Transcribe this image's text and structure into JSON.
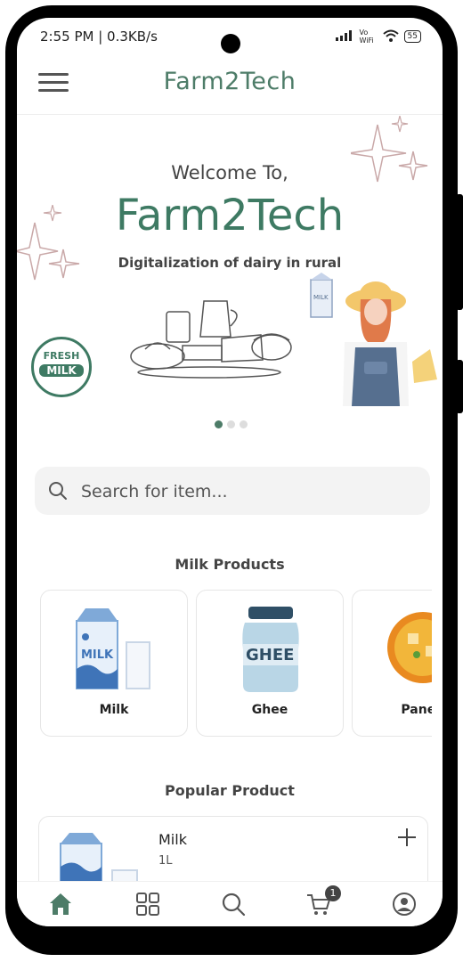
{
  "status_bar": {
    "time": "2:55 PM | 0.3KB/s",
    "network_label": "Vo WiFi",
    "battery": "55"
  },
  "app_bar": {
    "title": "Farm2Tech"
  },
  "banner": {
    "welcome": "Welcome To,",
    "brand": "Farm2Tech",
    "tagline": "Digitalization of dairy in rural",
    "badge_line1": "FRESH",
    "badge_line2": "MILK",
    "carton_label": "MILK",
    "slides": 3,
    "active_slide": 1
  },
  "search": {
    "placeholder": "Search for item..."
  },
  "milk_products": {
    "title": "Milk Products",
    "items": [
      {
        "label": "Milk",
        "icon": "milk-carton-icon",
        "image_text": "MILK"
      },
      {
        "label": "Ghee",
        "icon": "ghee-jar-icon",
        "image_text": "GHEE"
      },
      {
        "label": "Paneer",
        "icon": "paneer-dish-icon"
      }
    ]
  },
  "popular": {
    "title": "Popular Product",
    "items": [
      {
        "name": "Milk",
        "quantity": "1L",
        "icon": "milk-carton-icon"
      }
    ]
  },
  "bottom_nav": {
    "cart_count": "1",
    "items": [
      "home-icon",
      "categories-icon",
      "search-icon",
      "cart-icon",
      "profile-icon"
    ]
  },
  "colors": {
    "brand": "#4d7c68",
    "muted": "#555555",
    "card_border": "#e6e6e6"
  }
}
